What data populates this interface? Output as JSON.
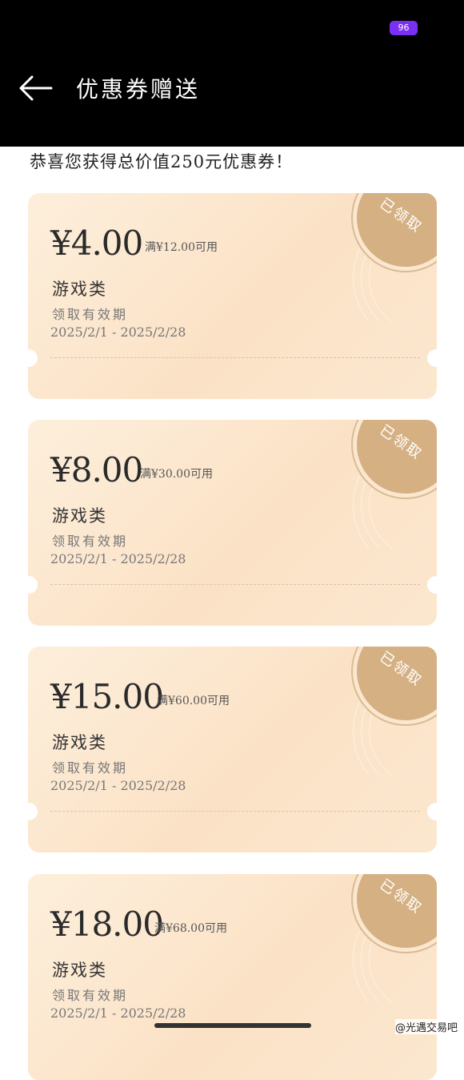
{
  "status_bar": {
    "battery": "96"
  },
  "header": {
    "title": "优惠券赠送"
  },
  "congrats": "恭喜您获得总价值250元优惠券！",
  "coupons": [
    {
      "amount": "¥4.00",
      "condition": "满¥12.00可用",
      "category": "游戏类",
      "validity_label": "领取有效期",
      "validity_range": "2025/2/1 - 2025/2/28",
      "stamp": "已领取"
    },
    {
      "amount": "¥8.00",
      "condition": "满¥30.00可用",
      "category": "游戏类",
      "validity_label": "领取有效期",
      "validity_range": "2025/2/1 - 2025/2/28",
      "stamp": "已领取"
    },
    {
      "amount": "¥15.00",
      "condition": "满¥60.00可用",
      "category": "游戏类",
      "validity_label": "领取有效期",
      "validity_range": "2025/2/1 - 2025/2/28",
      "stamp": "已领取"
    },
    {
      "amount": "¥18.00",
      "condition": "满¥68.00可用",
      "category": "游戏类",
      "validity_label": "领取有效期",
      "validity_range": "2025/2/1 - 2025/2/28",
      "stamp": "已领取"
    }
  ],
  "watermark": "@光遇交易吧",
  "colors": {
    "coupon_bg": "#fbe7cf",
    "stamp": "#d5b083",
    "header_bg": "#000000"
  }
}
